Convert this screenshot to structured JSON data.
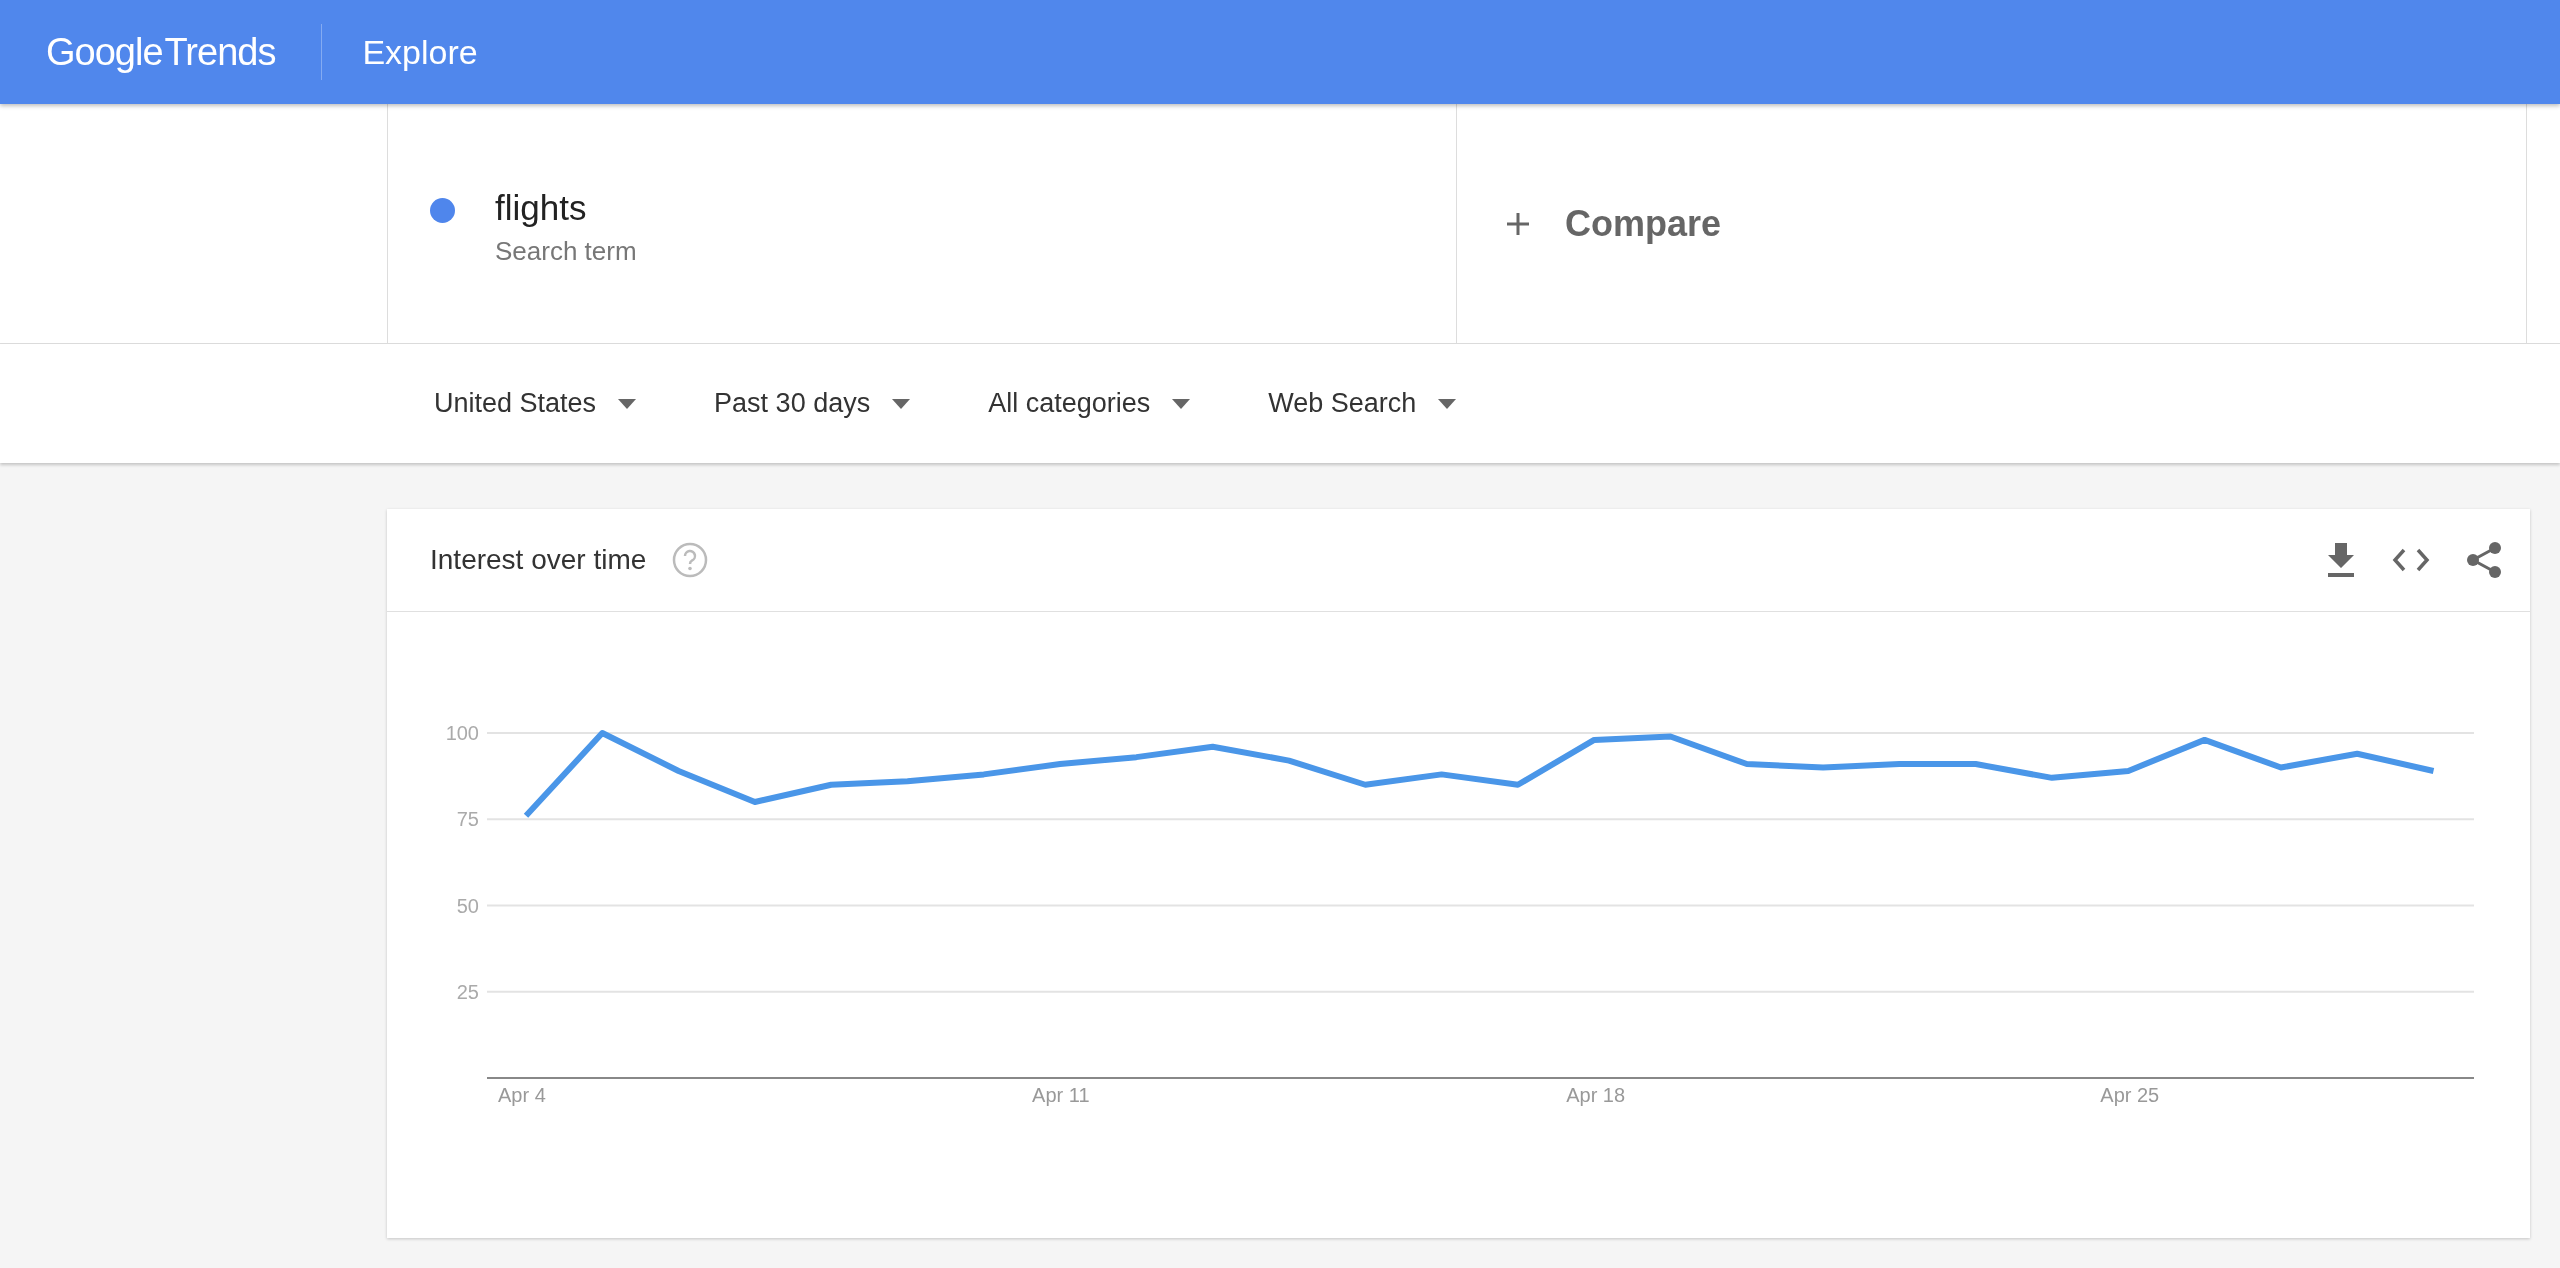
{
  "header": {
    "logo": {
      "brand": "Google",
      "product": "Trends"
    },
    "title": "Explore"
  },
  "search_terms": [
    {
      "term": "flights",
      "subtitle": "Search term",
      "color": "#4f86ec"
    }
  ],
  "compare": {
    "label": "Compare"
  },
  "filters": [
    "United States",
    "Past 30 days",
    "All categories",
    "Web Search"
  ],
  "interest_over_time": {
    "title": "Interest over time",
    "chart_data": {
      "type": "line",
      "categories": [
        "Apr 4",
        null,
        null,
        null,
        null,
        null,
        null,
        "Apr 11",
        null,
        null,
        null,
        null,
        null,
        null,
        "Apr 18",
        null,
        null,
        null,
        null,
        null,
        null,
        "Apr 25",
        null,
        null,
        null,
        null
      ],
      "ylim": [
        0,
        100
      ],
      "grid": true,
      "yticks": [
        25,
        50,
        75,
        100
      ],
      "series": [
        {
          "color": "#4a96e8",
          "values": [
            76,
            100,
            89,
            80,
            85,
            86,
            88,
            91,
            93,
            96,
            92,
            85,
            88,
            85,
            98,
            99,
            91,
            90,
            91,
            91,
            87,
            89,
            98,
            90,
            94,
            89
          ]
        }
      ]
    }
  }
}
